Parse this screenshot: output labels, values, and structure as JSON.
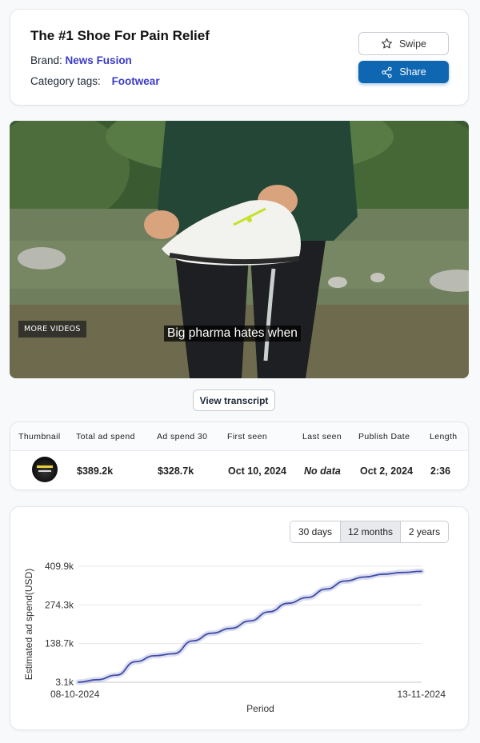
{
  "header": {
    "title": "The #1 Shoe For Pain Relief",
    "brand_label": "Brand:",
    "brand_value": "News Fusion",
    "category_label": "Category tags:",
    "category_value": "Footwear",
    "swipe_label": "Swipe",
    "share_label": "Share",
    "swipe_icon": "star-icon",
    "share_icon": "share-icon"
  },
  "video": {
    "more_videos_label": "MORE VIDEOS",
    "caption": "Big pharma hates when"
  },
  "transcript_label": "View transcript",
  "table": {
    "headers": [
      "Thumbnail",
      "Total ad spend",
      "Ad spend 30",
      "First seen",
      "Last seen",
      "Publish Date",
      "Length"
    ],
    "row": {
      "total_ad_spend": "$389.2k",
      "ad_spend_30": "$328.7k",
      "first_seen": "Oct 10, 2024",
      "last_seen": "No data",
      "publish_date": "Oct 2, 2024",
      "length": "2:36"
    }
  },
  "range_tabs": {
    "options": [
      "30 days",
      "12 months",
      "2 years"
    ],
    "selected": "12 months"
  },
  "chart_data": {
    "type": "line",
    "ylabel": "Estimated ad spend(USD)",
    "xlabel": "Period",
    "x_tick_labels": [
      "08-10-2024",
      "13-11-2024"
    ],
    "y_tick_labels": [
      "3.1k",
      "138.7k",
      "274.3k",
      "409.9k"
    ],
    "ylim": [
      3.1,
      409.9
    ],
    "grid": true,
    "line_color": "#3b4aa8",
    "series": [
      {
        "values": [
          3.1,
          12,
          28,
          75,
          96,
          103,
          148,
          175,
          192,
          218,
          250,
          280,
          300,
          330,
          358,
          372,
          382,
          388,
          392
        ]
      }
    ]
  },
  "colors": {
    "accent": "#0f67b1",
    "brand_link": "#3b3bc7",
    "line": "#3b4aa8"
  }
}
